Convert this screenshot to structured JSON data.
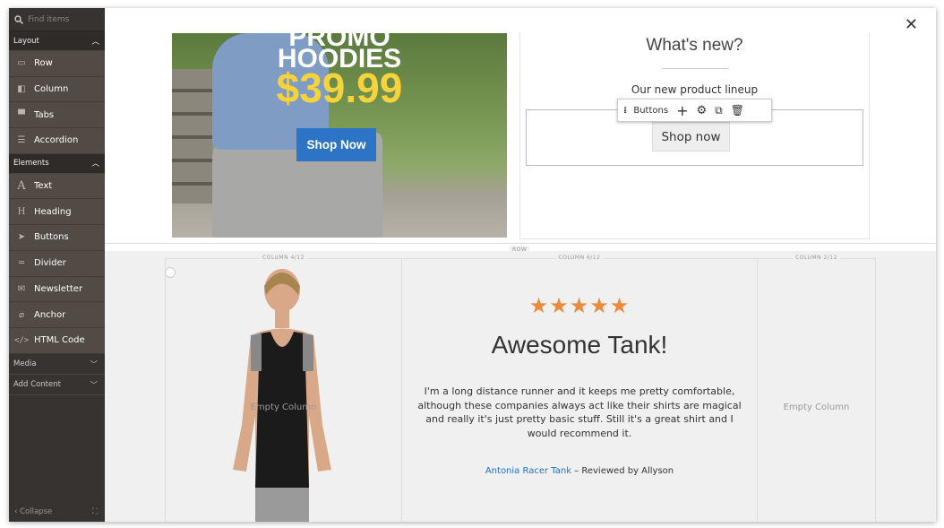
{
  "sidebar": {
    "search_placeholder": "Find items",
    "groups": [
      {
        "label": "Layout",
        "items": [
          {
            "label": "Row",
            "icon": "row-icon"
          },
          {
            "label": "Column",
            "icon": "column-icon"
          },
          {
            "label": "Tabs",
            "icon": "tabs-icon"
          },
          {
            "label": "Accordion",
            "icon": "accordion-icon"
          }
        ]
      },
      {
        "label": "Elements",
        "items": [
          {
            "label": "Text",
            "icon": "text-icon"
          },
          {
            "label": "Heading",
            "icon": "heading-icon"
          },
          {
            "label": "Buttons",
            "icon": "cursor-icon"
          },
          {
            "label": "Divider",
            "icon": "divider-icon"
          },
          {
            "label": "Newsletter",
            "icon": "envelope-icon"
          },
          {
            "label": "Anchor",
            "icon": "anchor-icon"
          },
          {
            "label": "HTML Code",
            "icon": "code-icon"
          }
        ]
      }
    ],
    "collapsed": [
      {
        "label": "Media"
      },
      {
        "label": "Add Content"
      }
    ],
    "collapse_label": "Collapse"
  },
  "promo": {
    "line1": "PROMO",
    "line2": "HOODIES",
    "price": "$39.99",
    "button": "Shop Now"
  },
  "whats_new": {
    "title": "What's new?",
    "subtitle": "Our new product lineup",
    "button": "Shop now",
    "toolbar_label": "Buttons"
  },
  "row": {
    "label": "ROW",
    "columns": [
      {
        "label": "COLUMN 4/12",
        "empty": "Empty Column"
      },
      {
        "label": "COLUMN 6/12"
      },
      {
        "label": "COLUMN 2/12",
        "empty": "Empty Column"
      }
    ]
  },
  "review": {
    "stars": "★★★★★",
    "rating": 5,
    "title": "Awesome Tank!",
    "body": "I'm a long distance runner and it keeps me pretty comfortable, although these companies always act like their shirts are magical and really it's just pretty basic stuff. Still it's a great shirt and I would recommend it.",
    "product_link": "Antonia Racer Tank",
    "reviewed_by": " – Reviewed by Allyson"
  },
  "colors": {
    "sidebar": "#373330",
    "accent_blue": "#2e74c6",
    "star": "#ea8a3c",
    "price": "#f6d33c"
  }
}
